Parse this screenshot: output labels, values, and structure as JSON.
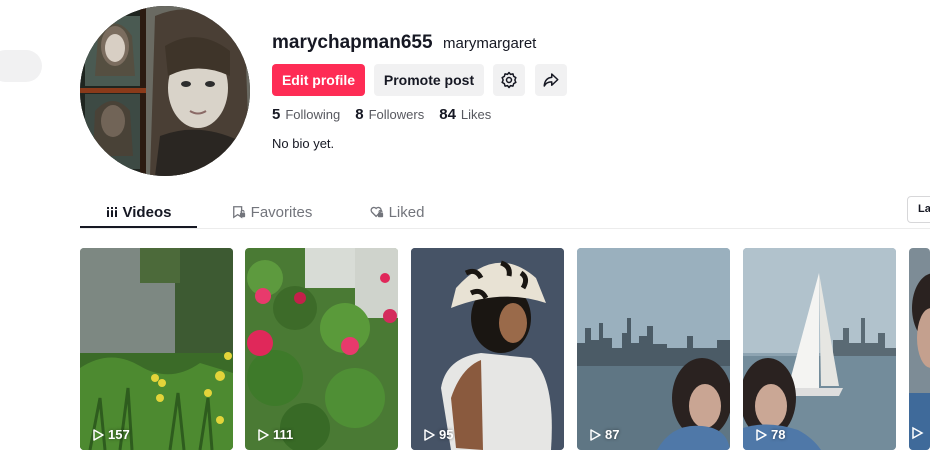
{
  "profile": {
    "username": "marychapman655",
    "nickname": "marymargaret",
    "bio": "No bio yet."
  },
  "actions": {
    "edit_profile": "Edit profile",
    "promote_post": "Promote post"
  },
  "stats": {
    "following_count": "5",
    "following_label": "Following",
    "followers_count": "8",
    "followers_label": "Followers",
    "likes_count": "84",
    "likes_label": "Likes"
  },
  "tabs": {
    "videos": "Videos",
    "favorites": "Favorites",
    "liked": "Liked"
  },
  "sort": {
    "label": "La"
  },
  "videos": [
    {
      "views": "157"
    },
    {
      "views": "111"
    },
    {
      "views": "95"
    },
    {
      "views": "87"
    },
    {
      "views": "78"
    }
  ],
  "colors": {
    "accent": "#fe2c55",
    "button_secondary": "#f1f1f2",
    "text_primary": "#161823",
    "text_secondary": "#73757c"
  }
}
